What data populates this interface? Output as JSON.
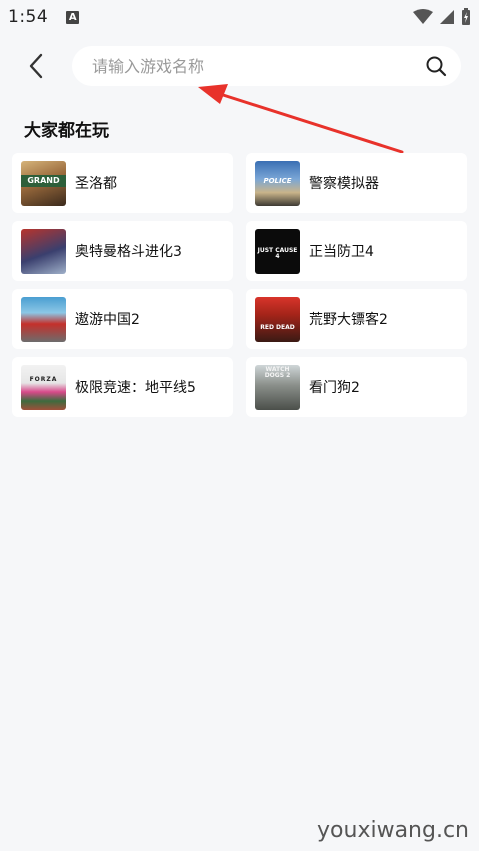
{
  "status_bar": {
    "time": "1:54",
    "a_icon": "A"
  },
  "search": {
    "placeholder": "请输入游戏名称",
    "value": ""
  },
  "section": {
    "title": "大家都在玩"
  },
  "games": [
    {
      "name": "圣洛都",
      "thumb_text": "GRAND"
    },
    {
      "name": "警察模拟器",
      "thumb_text": "POLICE"
    },
    {
      "name": "奥特曼格斗进化3",
      "thumb_text": ""
    },
    {
      "name": "正当防卫4",
      "thumb_text": "JUST CAUSE 4"
    },
    {
      "name": "遨游中国2",
      "thumb_text": ""
    },
    {
      "name": "荒野大镖客2",
      "thumb_text": "RED DEAD"
    },
    {
      "name": "极限竞速：地平线5",
      "thumb_text": "FORZA"
    },
    {
      "name": "看门狗2",
      "thumb_text": "WATCH DOGS 2"
    }
  ],
  "watermark": "youxiwang.cn",
  "colors": {
    "background": "#f6f7f9",
    "card": "#ffffff",
    "arrow": "#e8322b"
  }
}
